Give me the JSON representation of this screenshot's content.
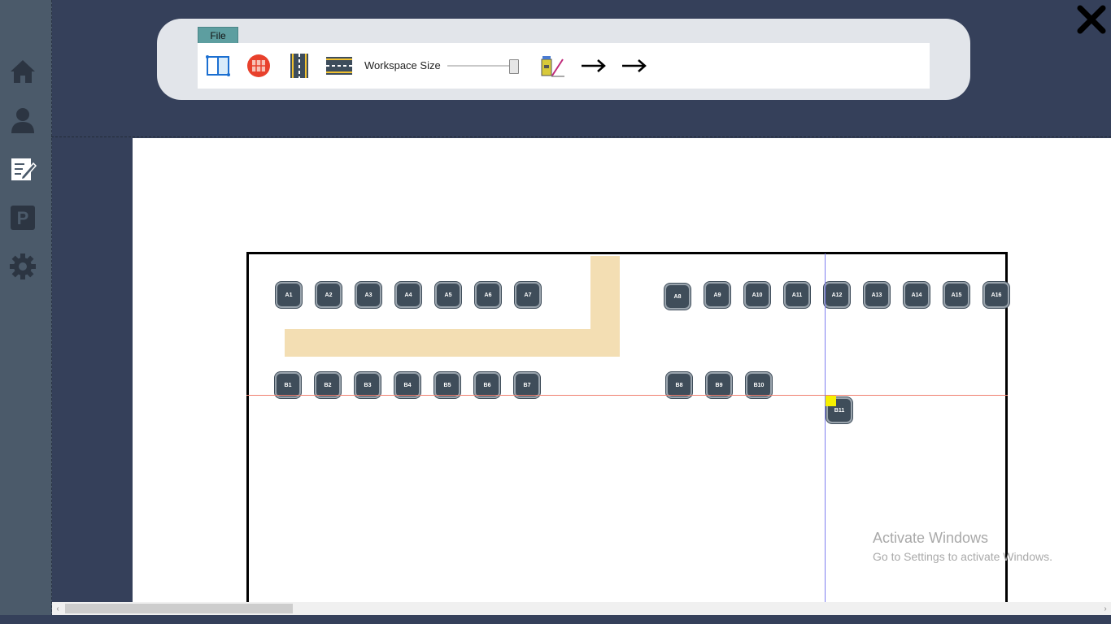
{
  "rail": {
    "items": [
      {
        "name": "home",
        "icon": "home-icon"
      },
      {
        "name": "user",
        "icon": "user-icon"
      },
      {
        "name": "editor",
        "icon": "edit-icon"
      },
      {
        "name": "parking",
        "icon": "parking-icon",
        "glyph": "P"
      },
      {
        "name": "settings",
        "icon": "gear-icon"
      }
    ]
  },
  "toolbar": {
    "file_label": "File",
    "workspace_size_label": "Workspace Size",
    "workspace_size_level": 0.92,
    "tools": [
      "frame-tool-icon",
      "grid-tool-icon",
      "vertical-road-tool-icon",
      "horizontal-road-tool-icon",
      "paint-tool-icon",
      "arrow-right-icon",
      "arrow-right-icon"
    ]
  },
  "slots": {
    "row_a": [
      "A1",
      "A2",
      "A3",
      "A4",
      "A5",
      "A6",
      "A7",
      "A8",
      "A9",
      "A10",
      "A11",
      "A12",
      "A13",
      "A14",
      "A15",
      "A16"
    ],
    "row_b": [
      "B1",
      "B2",
      "B3",
      "B4",
      "B5",
      "B6",
      "B7",
      "B8",
      "B9",
      "B10",
      "B11"
    ]
  },
  "watermark": {
    "title": "Activate Windows",
    "subtitle": "Go to Settings to activate Windows."
  },
  "colors": {
    "slot_fill": "#3f4d5a",
    "road": "#f3deb3",
    "guide_horizontal": "#f08070",
    "guide_vertical": "#7f7ff0",
    "selection_handle": "#f7f000",
    "file_tab": "#5d9ea0"
  }
}
